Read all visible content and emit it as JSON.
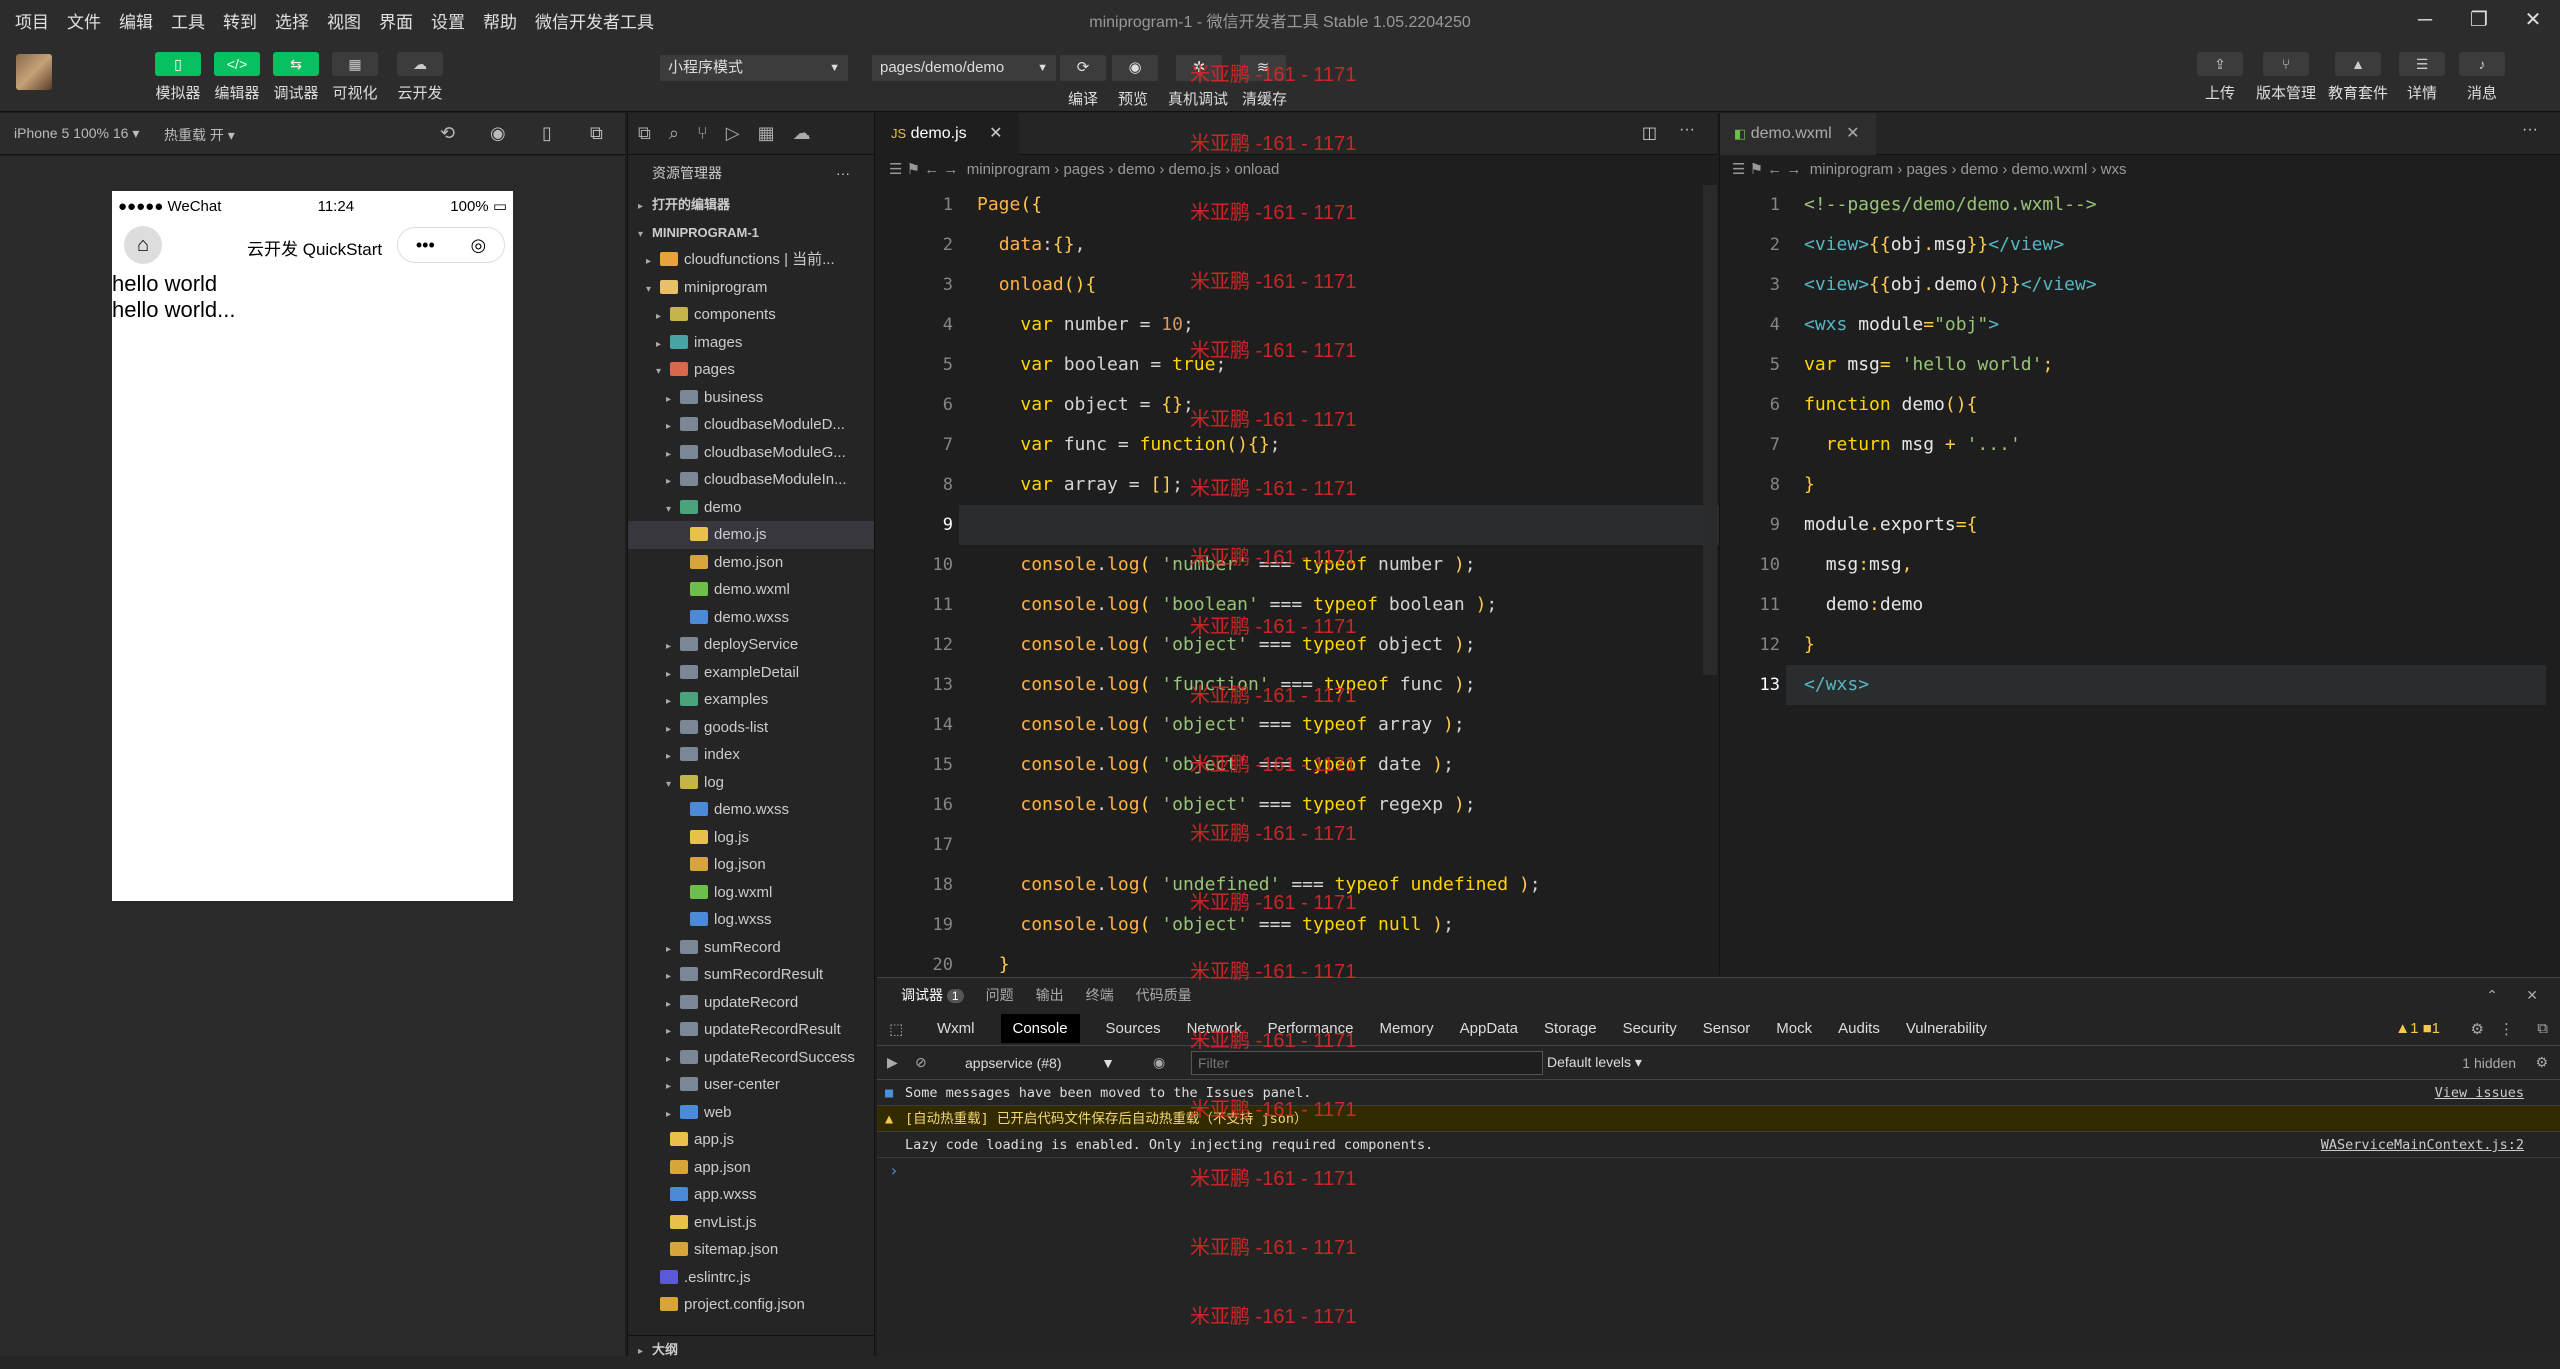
{
  "menu": [
    "项目",
    "文件",
    "编辑",
    "工具",
    "转到",
    "选择",
    "视图",
    "界面",
    "设置",
    "帮助",
    "微信开发者工具"
  ],
  "window_title": "miniprogram-1 - 微信开发者工具 Stable 1.05.2204250",
  "toolbar": {
    "left_buttons": [
      "模拟器",
      "编辑器",
      "调试器",
      "可视化",
      "云开发"
    ],
    "mode_select": "小程序模式",
    "page_select": "pages/demo/demo",
    "center_labels": [
      "编译",
      "预览",
      "真机调试",
      "清缓存"
    ],
    "right_buttons": [
      "上传",
      "版本管理",
      "教育套件",
      "详情",
      "消息"
    ]
  },
  "simulator": {
    "device": "iPhone 5 100% 16",
    "hot_reload": "热重载 开",
    "status_carrier": "●●●●● WeChat",
    "status_time": "11:24",
    "status_battery": "100%",
    "nav_title": "云开发 QuickStart",
    "content_lines": [
      "hello world",
      "hello world..."
    ]
  },
  "explorer": {
    "title": "资源管理器",
    "open_editors": "打开的编辑器",
    "project": "MINIPROGRAM-1",
    "outline": "大纲",
    "items": [
      {
        "label": "cloudfunctions | 当前...",
        "depth": 1,
        "arrow": "▸",
        "color": "#e8a33d"
      },
      {
        "label": "miniprogram",
        "depth": 1,
        "arrow": "▾",
        "color": "#e8c06a"
      },
      {
        "label": "components",
        "depth": 2,
        "arrow": "▸",
        "color": "#c5b447"
      },
      {
        "label": "images",
        "depth": 2,
        "arrow": "▸",
        "color": "#4aa3a3"
      },
      {
        "label": "pages",
        "depth": 2,
        "arrow": "▾",
        "color": "#d9684a"
      },
      {
        "label": "business",
        "depth": 3,
        "arrow": "▸",
        "color": "#7b8794"
      },
      {
        "label": "cloudbaseModuleD...",
        "depth": 3,
        "arrow": "▸",
        "color": "#7b8794"
      },
      {
        "label": "cloudbaseModuleG...",
        "depth": 3,
        "arrow": "▸",
        "color": "#7b8794"
      },
      {
        "label": "cloudbaseModuleIn...",
        "depth": 3,
        "arrow": "▸",
        "color": "#7b8794"
      },
      {
        "label": "demo",
        "depth": 3,
        "arrow": "▾",
        "color": "#4aa37a"
      },
      {
        "label": "demo.js",
        "depth": 4,
        "arrow": "",
        "color": "#e8c04a",
        "active": true
      },
      {
        "label": "demo.json",
        "depth": 4,
        "arrow": "",
        "color": "#d8a53a"
      },
      {
        "label": "demo.wxml",
        "depth": 4,
        "arrow": "",
        "color": "#6cbf4a"
      },
      {
        "label": "demo.wxss",
        "depth": 4,
        "arrow": "",
        "color": "#4a8ad8"
      },
      {
        "label": "deployService",
        "depth": 3,
        "arrow": "▸",
        "color": "#7b8794"
      },
      {
        "label": "exampleDetail",
        "depth": 3,
        "arrow": "▸",
        "color": "#7b8794"
      },
      {
        "label": "examples",
        "depth": 3,
        "arrow": "▸",
        "color": "#4aa37a"
      },
      {
        "label": "goods-list",
        "depth": 3,
        "arrow": "▸",
        "color": "#7b8794"
      },
      {
        "label": "index",
        "depth": 3,
        "arrow": "▸",
        "color": "#7b8794"
      },
      {
        "label": "log",
        "depth": 3,
        "arrow": "▾",
        "color": "#c5b447"
      },
      {
        "label": "demo.wxss",
        "depth": 4,
        "arrow": "",
        "color": "#4a8ad8"
      },
      {
        "label": "log.js",
        "depth": 4,
        "arrow": "",
        "color": "#e8c04a"
      },
      {
        "label": "log.json",
        "depth": 4,
        "arrow": "",
        "color": "#d8a53a"
      },
      {
        "label": "log.wxml",
        "depth": 4,
        "arrow": "",
        "color": "#6cbf4a"
      },
      {
        "label": "log.wxss",
        "depth": 4,
        "arrow": "",
        "color": "#4a8ad8"
      },
      {
        "label": "sumRecord",
        "depth": 3,
        "arrow": "▸",
        "color": "#7b8794"
      },
      {
        "label": "sumRecordResult",
        "depth": 3,
        "arrow": "▸",
        "color": "#7b8794"
      },
      {
        "label": "updateRecord",
        "depth": 3,
        "arrow": "▸",
        "color": "#7b8794"
      },
      {
        "label": "updateRecordResult",
        "depth": 3,
        "arrow": "▸",
        "color": "#7b8794"
      },
      {
        "label": "updateRecordSuccess",
        "depth": 3,
        "arrow": "▸",
        "color": "#7b8794"
      },
      {
        "label": "user-center",
        "depth": 3,
        "arrow": "▸",
        "color": "#7b8794"
      },
      {
        "label": "web",
        "depth": 3,
        "arrow": "▸",
        "color": "#4a8ad8"
      },
      {
        "label": "app.js",
        "depth": 2,
        "arrow": "",
        "color": "#e8c04a"
      },
      {
        "label": "app.json",
        "depth": 2,
        "arrow": "",
        "color": "#d8a53a"
      },
      {
        "label": "app.wxss",
        "depth": 2,
        "arrow": "",
        "color": "#4a8ad8"
      },
      {
        "label": "envList.js",
        "depth": 2,
        "arrow": "",
        "color": "#e8c04a"
      },
      {
        "label": "sitemap.json",
        "depth": 2,
        "arrow": "",
        "color": "#d8a53a"
      },
      {
        "label": ".eslintrc.js",
        "depth": 1,
        "arrow": "",
        "color": "#5a5ad8"
      },
      {
        "label": "project.config.json",
        "depth": 1,
        "arrow": "",
        "color": "#d8a53a"
      }
    ]
  },
  "editor1": {
    "tab": "demo.js",
    "breadcrumb": "miniprogram › pages › demo › demo.js › onload",
    "current_line": 9,
    "lines": [
      "Page({",
      "  data:{},",
      "  onload(){",
      "    var number = 10;",
      "    var boolean = true;",
      "    var object = {};",
      "    var func = function(){};",
      "    var array = [];",
      "",
      "    console.log( 'number' === typeof number );",
      "    console.log( 'boolean' === typeof boolean );",
      "    console.log( 'object' === typeof object );",
      "    console.log( 'function' === typeof func );",
      "    console.log( 'object' === typeof array );",
      "    console.log( 'object' === typeof date );",
      "    console.log( 'object' === typeof regexp );",
      "",
      "    console.log( 'undefined' === typeof undefined );",
      "    console.log( 'object' === typeof null );",
      "  }"
    ]
  },
  "editor2": {
    "tab": "demo.wxml",
    "breadcrumb": "miniprogram › pages › demo › demo.wxml › wxs",
    "current_line": 13,
    "lines": [
      "<!--pages/demo/demo.wxml-->",
      "<view>{{obj.msg}}</view>",
      "<view>{{obj.demo()}}</view>",
      "<wxs module=\"obj\">",
      "var msg= 'hello world';",
      "function demo(){",
      "  return msg + '...'",
      "}",
      "module.exports={",
      "  msg:msg,",
      "  demo:demo",
      "}",
      "</wxs>"
    ]
  },
  "devtools": {
    "top_tabs": [
      "调试器",
      "1",
      "问题",
      "输出",
      "终端",
      "代码质量"
    ],
    "panels": [
      "Wxml",
      "Console",
      "Sources",
      "Network",
      "Performance",
      "Memory",
      "AppData",
      "Storage",
      "Security",
      "Sensor",
      "Mock",
      "Audits",
      "Vulnerability"
    ],
    "context": "appservice (#8)",
    "filter_placeholder": "Filter",
    "levels": "Default levels",
    "hidden": "1 hidden",
    "badges": "▲1 ■1",
    "messages": [
      {
        "text": "Some messages have been moved to the Issues panel.",
        "link": "View issues",
        "type": "info"
      },
      {
        "text": "[自动热重载] 已开启代码文件保存后自动热重载（不支持 json）",
        "link": "",
        "type": "warn"
      },
      {
        "text": "Lazy code loading is enabled. Only injecting required components.",
        "link": "WAServiceMainContext.js:2",
        "type": "log"
      }
    ]
  },
  "watermark": "米亚鹏 -161 - 1171",
  "colors": {
    "accent": "#07c160",
    "bg": "#1e1e1e",
    "watermark": "#dc2828"
  }
}
